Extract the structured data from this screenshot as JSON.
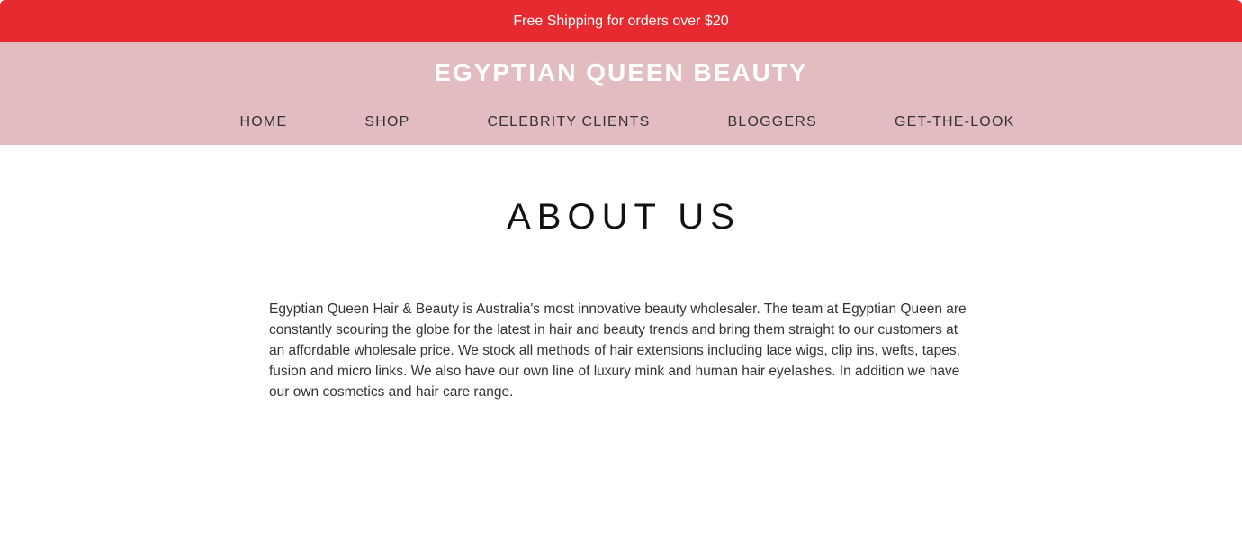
{
  "announcement": {
    "text": "Free Shipping for orders over $20"
  },
  "header": {
    "logo": "EGYPTIAN QUEEN BEAUTY",
    "nav": [
      {
        "label": "HOME"
      },
      {
        "label": "SHOP"
      },
      {
        "label": "CELEBRITY CLIENTS"
      },
      {
        "label": "BLOGGERS"
      },
      {
        "label": "GET-THE-LOOK"
      }
    ]
  },
  "main": {
    "title": "ABOUT US",
    "body": "Egyptian Queen Hair & Beauty is Australia's most innovative beauty wholesaler. The team at Egyptian Queen are constantly scouring the globe for the latest in hair and beauty trends and bring them straight to our customers at an affordable wholesale price. We  stock all  methods of hair extensions including lace wigs, clip ins, wefts, tapes, fusion and micro links. We also have our own line of luxury mink and human hair eyelashes. In addition we have our own cosmetics and hair care range."
  },
  "colors": {
    "announcement_bg": "#e62a2f",
    "header_bg": "#e2bcc1"
  }
}
